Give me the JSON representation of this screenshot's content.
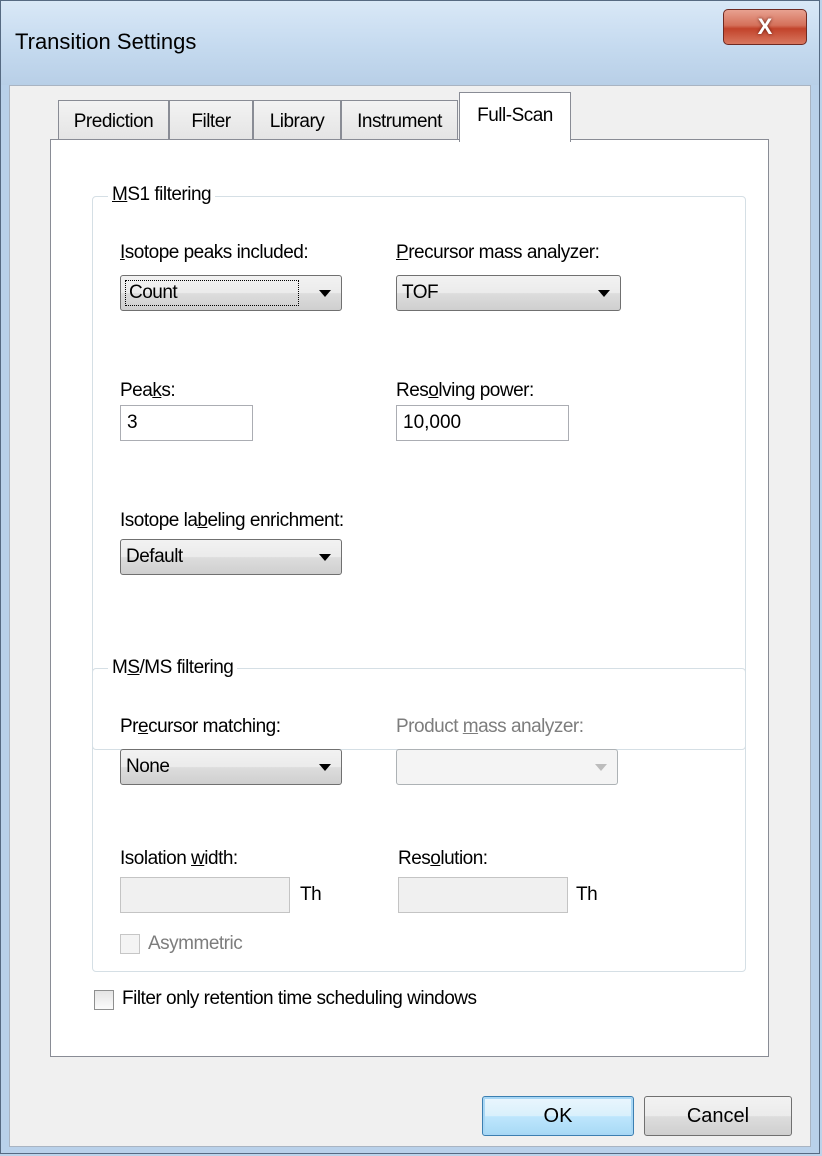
{
  "window": {
    "title": "Transition Settings",
    "close_glyph": "X"
  },
  "tabs": [
    {
      "label": "Prediction",
      "active": false
    },
    {
      "label": "Filter",
      "active": false
    },
    {
      "label": "Library",
      "active": false
    },
    {
      "label": "Instrument",
      "active": false
    },
    {
      "label": "Full-Scan",
      "active": true
    }
  ],
  "ms1": {
    "legend": "MS1 filtering",
    "isotope_peaks": {
      "label": "Isotope peaks included:",
      "value": "Count"
    },
    "precursor_analyzer": {
      "label": "Precursor mass analyzer:",
      "value": "TOF"
    },
    "peaks": {
      "label": "Peaks:",
      "value": "3"
    },
    "resolving_power": {
      "label": "Resolving power:",
      "value": "10,000"
    },
    "enrichment": {
      "label": "Isotope labeling enrichment:",
      "value": "Default"
    }
  },
  "msms": {
    "legend": "MS/MS filtering",
    "precursor_matching": {
      "label": "Precursor matching:",
      "value": "None"
    },
    "product_analyzer": {
      "label": "Product mass analyzer:",
      "value": ""
    },
    "isolation_width": {
      "label": "Isolation width:",
      "value": "",
      "unit": "Th"
    },
    "resolution": {
      "label": "Resolution:",
      "value": "",
      "unit": "Th"
    },
    "asymmetric": {
      "label": "Asymmetric",
      "checked": false
    }
  },
  "filter_rt": {
    "label": "Filter only retention time scheduling windows",
    "checked": false
  },
  "buttons": {
    "ok": "OK",
    "cancel": "Cancel"
  }
}
